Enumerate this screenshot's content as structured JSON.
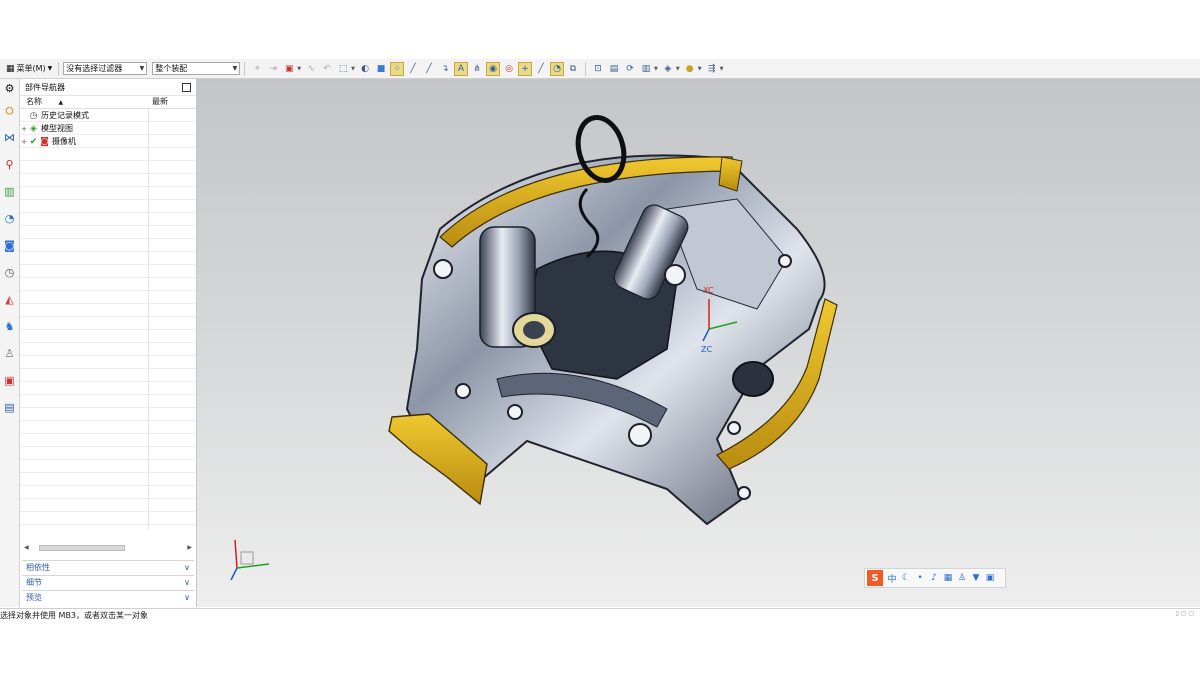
{
  "toolbar": {
    "menu_label": "菜单(M)",
    "filter_value": "没有选择过滤器",
    "assembly_value": "整个装配"
  },
  "navigator": {
    "title": "部件导航器",
    "col_name": "名称",
    "col_latest": "最新",
    "sort_glyph": "▲",
    "items": [
      {
        "label": "历史记录模式"
      },
      {
        "label": "模型视图"
      },
      {
        "label": "摄像机"
      }
    ],
    "sections": [
      {
        "label": "相依性"
      },
      {
        "label": "细节"
      },
      {
        "label": "预览"
      }
    ]
  },
  "viewport": {
    "wcs_x_label": "XC",
    "wcs_z_label": "ZC"
  },
  "ime": {
    "logo": "S",
    "mode": "中"
  },
  "statusbar": {
    "prompt": "选择对象并使用 MB3，或者双击某一对象"
  },
  "colors": {
    "accent_blue": "#2b5cab",
    "highlight_yellow": "#e2b624",
    "ime_orange": "#f15a22"
  }
}
